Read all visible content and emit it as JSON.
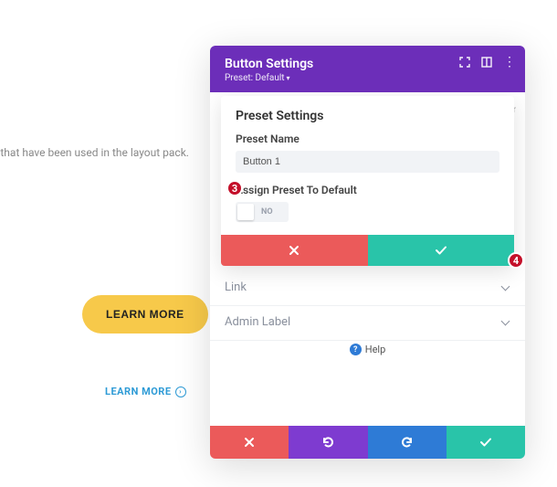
{
  "background": {
    "partial_text": "ttons that have been used in the layout pack.",
    "learn_more_button": "LEARN MORE",
    "learn_more_link": "LEARN MORE"
  },
  "panel": {
    "title": "Button Settings",
    "preset_label": "Preset: Default",
    "truncated_tab": "er",
    "vdots": "⋮",
    "sections": {
      "link": "Link",
      "admin": "Admin Label"
    },
    "help": "Help"
  },
  "preset_card": {
    "heading": "Preset Settings",
    "name_label": "Preset Name",
    "name_value": "Button 1",
    "assign_label": "Assign Preset To Default",
    "toggle_value": "NO"
  },
  "badges": {
    "b3": "3",
    "b4": "4"
  }
}
